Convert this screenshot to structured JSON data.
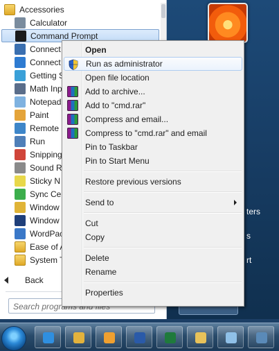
{
  "start_menu": {
    "programs": [
      {
        "label": "Accessories",
        "type": "folder",
        "indent": false,
        "icon": "folder-icon"
      },
      {
        "label": "Calculator",
        "icon": "calculator-icon"
      },
      {
        "label": "Command Prompt",
        "icon": "command-prompt-icon",
        "selected": true
      },
      {
        "label": "Connect",
        "icon": "connect-projector-icon"
      },
      {
        "label": "Connect",
        "icon": "remote-desktop-icon"
      },
      {
        "label": "Getting S",
        "icon": "getting-started-icon"
      },
      {
        "label": "Math Inp",
        "icon": "math-input-icon"
      },
      {
        "label": "Notepad",
        "icon": "notepad-icon"
      },
      {
        "label": "Paint",
        "icon": "paint-icon"
      },
      {
        "label": "Remote",
        "icon": "remote-icon"
      },
      {
        "label": "Run",
        "icon": "run-icon"
      },
      {
        "label": "Snipping",
        "icon": "snipping-tool-icon"
      },
      {
        "label": "Sound R",
        "icon": "sound-recorder-icon"
      },
      {
        "label": "Sticky N",
        "icon": "sticky-notes-icon"
      },
      {
        "label": "Sync Cen",
        "icon": "sync-center-icon"
      },
      {
        "label": "Window",
        "icon": "windows-explorer-icon"
      },
      {
        "label": "Window",
        "icon": "windows-powershell-icon"
      },
      {
        "label": "WordPac",
        "icon": "wordpad-icon"
      },
      {
        "label": "Ease of A",
        "icon": "folder-icon",
        "folder": true
      },
      {
        "label": "System T",
        "icon": "folder-icon",
        "folder": true
      }
    ],
    "back_label": "Back",
    "search_placeholder": "Search programs and files",
    "right_pane": {
      "partial_items": [
        "ters",
        "s",
        "rt"
      ]
    }
  },
  "context_menu": {
    "items": [
      {
        "label": "Open",
        "bold": true
      },
      {
        "label": "Run as administrator",
        "icon": "uac-shield-icon",
        "hover": true
      },
      {
        "label": "Open file location"
      },
      {
        "label": "Add to archive...",
        "icon": "winrar-icon"
      },
      {
        "label": "Add to \"cmd.rar\"",
        "icon": "winrar-icon"
      },
      {
        "label": "Compress and email...",
        "icon": "winrar-icon"
      },
      {
        "label": "Compress to \"cmd.rar\" and email",
        "icon": "winrar-icon"
      },
      {
        "label": "Pin to Taskbar"
      },
      {
        "label": "Pin to Start Menu"
      },
      {
        "separator": true
      },
      {
        "label": "Restore previous versions"
      },
      {
        "separator": true
      },
      {
        "label": "Send to",
        "submenu": true
      },
      {
        "separator": true
      },
      {
        "label": "Cut"
      },
      {
        "label": "Copy"
      },
      {
        "separator": true
      },
      {
        "label": "Delete"
      },
      {
        "label": "Rename"
      },
      {
        "separator": true
      },
      {
        "label": "Properties"
      }
    ]
  },
  "taskbar": {
    "buttons": [
      "internet-explorer-icon",
      "windows-explorer-icon",
      "outlook-icon",
      "word-icon",
      "excel-icon",
      "folder-icon",
      "notepad-icon",
      "app-icon"
    ]
  },
  "colors": {
    "accent": "#3b7fd0",
    "desktop": "#1c3f66",
    "menu_bg": "#f0f0f0"
  }
}
